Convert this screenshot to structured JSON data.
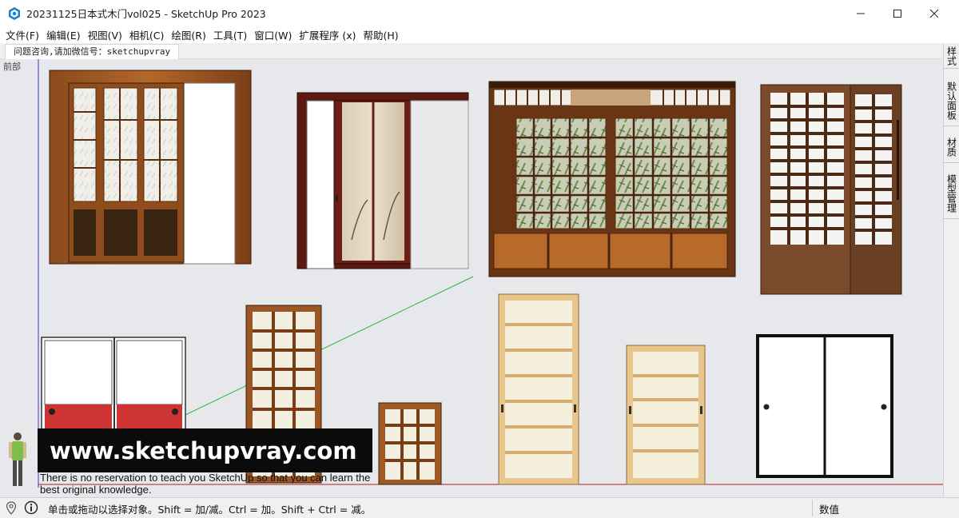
{
  "window": {
    "title": "20231125日本式木门vol025 - SketchUp Pro 2023",
    "minimize_icon": "minimize-icon",
    "maximize_icon": "maximize-icon",
    "close_icon": "close-icon"
  },
  "menu": {
    "items": [
      {
        "label": "文件(F)"
      },
      {
        "label": "编辑(E)"
      },
      {
        "label": "视图(V)"
      },
      {
        "label": "相机(C)"
      },
      {
        "label": "绘图(R)"
      },
      {
        "label": "工具(T)"
      },
      {
        "label": "窗口(W)"
      },
      {
        "label": "扩展程序 (x)"
      },
      {
        "label": "帮助(H)"
      }
    ]
  },
  "scene_tab": {
    "label": "问题咨询,请加微信号：sketchupvray"
  },
  "viewport": {
    "view_label": "前部",
    "background": "#e6e8eb",
    "axis_colors": {
      "green": "#2db83d",
      "red": "#c03030",
      "blue": "#3a3ac8"
    }
  },
  "watermark": {
    "url": "www.sketchupvray.com",
    "tagline": "There is no reservation to teach you SketchUp so that you can learn the best original knowledge."
  },
  "tray": {
    "tabs": [
      {
        "label": "样式"
      },
      {
        "label": "默认面板"
      },
      {
        "label": "材质"
      },
      {
        "label": "模型管理"
      }
    ]
  },
  "status": {
    "text": "单击或拖动以选择对象。Shift = 加/减。Ctrl = 加。Shift + Ctrl = 减。",
    "measurements_label": "数值",
    "icons": [
      "geolocation-icon",
      "instructor-info-icon"
    ]
  }
}
